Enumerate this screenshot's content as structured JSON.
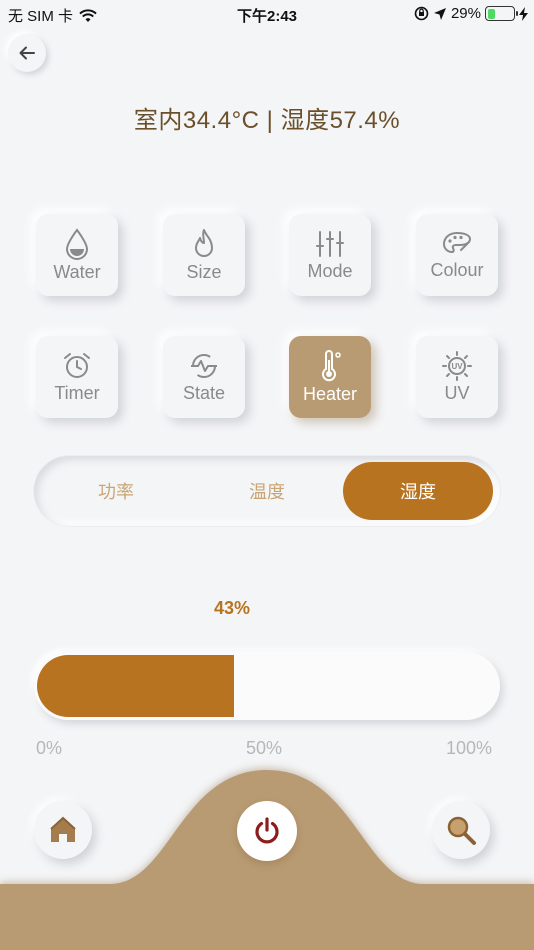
{
  "status_bar": {
    "carrier": "无 SIM 卡",
    "time": "下午2:43",
    "battery": "29%",
    "battery_level": 0.29
  },
  "header": {
    "readout": "室内34.4°C | 湿度57.4%"
  },
  "icons": {
    "back": "arrow-left-icon",
    "home": "home-icon",
    "power": "power-icon",
    "search": "search-icon"
  },
  "tiles": [
    {
      "label": "Water",
      "icon": "water-drop-icon"
    },
    {
      "label": "Size",
      "icon": "flame-icon"
    },
    {
      "label": "Mode",
      "icon": "sliders-icon"
    },
    {
      "label": "Colour",
      "icon": "palette-icon"
    },
    {
      "label": "Timer",
      "icon": "alarm-clock-icon"
    },
    {
      "label": "State",
      "icon": "pulse-icon"
    },
    {
      "label": "Heater",
      "icon": "thermometer-icon",
      "active": true
    },
    {
      "label": "UV",
      "icon": "uv-sun-icon"
    }
  ],
  "segments": [
    {
      "label": "功率"
    },
    {
      "label": "温度"
    },
    {
      "label": "湿度",
      "active": true
    }
  ],
  "slider": {
    "value_label": "43%",
    "value": 0.43,
    "ticks": [
      "0%",
      "50%",
      "100%"
    ]
  },
  "colors": {
    "accent": "#b87320",
    "active_tile": "#b99b73",
    "bottom_wave": "#b99b73",
    "power_icon": "#8c1d1d",
    "text_brown": "#6b4f2a"
  }
}
